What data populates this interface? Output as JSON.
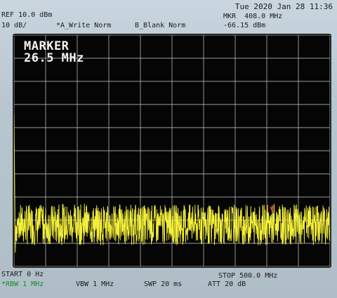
{
  "header": {
    "datetime": "Tue 2020 Jan 28 11:36",
    "ref_level": "REF 10.0 dBm",
    "scale": "10 dB/",
    "trace_a": "*A_Write Norm",
    "trace_b": "B_Blank Norm",
    "marker_freq": "MKR  408.0 MHz",
    "marker_level": "-66.15 dBm"
  },
  "display": {
    "marker_title": "MARKER",
    "marker_value": "26.5 MHz",
    "trace_color": "#f3ef3a",
    "marker_color": "#ff3030"
  },
  "footer": {
    "start": "START 0 Hz",
    "stop": "STOP 500.0 MHz",
    "rbw": "*RBW 1 MHz",
    "vbw": "VBW 1 MHz",
    "swp": "SWP 20 ms",
    "att": "ATT 20 dB"
  },
  "chart_data": {
    "type": "line",
    "x_unit": "MHz",
    "y_unit": "dBm",
    "xlim": [
      0,
      500
    ],
    "ylim": [
      -90,
      10
    ],
    "grid": true,
    "x_divisions": 10,
    "y_divisions": 10,
    "series": [
      {
        "values": [
          [
            0,
            -24
          ],
          [
            2,
            -84
          ],
          [
            5,
            -70
          ],
          [
            10,
            -70
          ],
          [
            50,
            -71
          ],
          [
            100,
            -71
          ],
          [
            150,
            -71
          ],
          [
            200,
            -71
          ],
          [
            250,
            -71
          ],
          [
            300,
            -71
          ],
          [
            350,
            -71
          ],
          [
            400,
            -71
          ],
          [
            408,
            -66.15
          ],
          [
            450,
            -71
          ],
          [
            500,
            -71
          ]
        ]
      }
    ],
    "noise_floor_dBm": -72,
    "noise_spread_dB": 8,
    "marker": {
      "x": 408,
      "y": -66.15
    }
  }
}
